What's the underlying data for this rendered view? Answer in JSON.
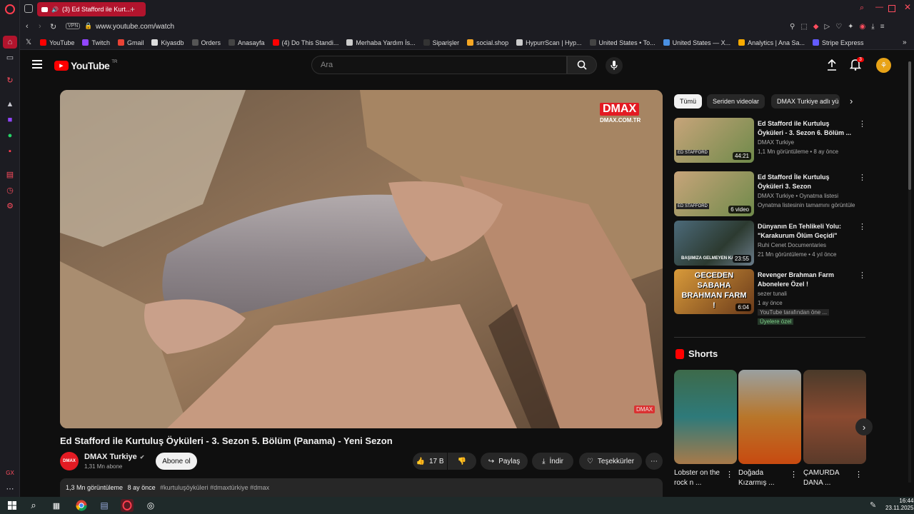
{
  "browser": {
    "tab_title": "(3) Ed Stafford ile Kurt...",
    "url": "www.youtube.com/watch",
    "vpn": "VPN",
    "bookmarks": [
      {
        "label": "YouTube",
        "color": "#ff0000"
      },
      {
        "label": "Twitch",
        "color": "#9146ff"
      },
      {
        "label": "Gmail",
        "color": "#ea4335"
      },
      {
        "label": "Kiyasdb",
        "color": "#dddddd"
      },
      {
        "label": "Orders",
        "color": "#555555"
      },
      {
        "label": "Anasayfa",
        "color": "#444444"
      },
      {
        "label": "(4) Do This Standi...",
        "color": "#ff0000"
      },
      {
        "label": "Merhaba Yardım İs...",
        "color": "#cccccc"
      },
      {
        "label": "Siparişler",
        "color": "#333333"
      },
      {
        "label": "social.shop",
        "color": "#f5a623"
      },
      {
        "label": "HypurrScan | Hyp...",
        "color": "#cccccc"
      },
      {
        "label": "United States • To...",
        "color": "#444444"
      },
      {
        "label": "United States — X...",
        "color": "#4a90e2"
      },
      {
        "label": "Analytics | Ana Sa...",
        "color": "#f9ab00"
      },
      {
        "label": "Stripe Express",
        "color": "#635bff"
      }
    ]
  },
  "youtube": {
    "logo_text": "YouTube",
    "logo_suffix": "TR",
    "search_placeholder": "Ara",
    "notif_count": "3",
    "video": {
      "channel_watermark": "DMAX",
      "watermark_sub": "DMAX.COM.TR",
      "title": "Ed Stafford ile Kurtuluş Öyküleri - 3. Sezon 5. Bölüm (Panama) - Yeni Sezon",
      "channel": "DMAX Turkiye",
      "subscribers": "1,31 Mn abone",
      "subscribe": "Abone ol",
      "likes": "17 B",
      "share": "Paylaş",
      "download": "İndir",
      "thanks": "Teşekkürler",
      "views_line": "1,3 Mn görüntüleme",
      "time_line": "8 ay önce",
      "hashtags": "#kurtuluşöyküleri #dmaxtürkiye #dmax"
    },
    "chips": [
      "Tümü",
      "Seriden videolar",
      "DMAX Turkiye adlı yü"
    ],
    "recommendations": [
      {
        "title": "Ed Stafford ile Kurtuluş Öyküleri - 3. Sezon 6. Bölüm ...",
        "channel": "DMAX Turkiye",
        "meta": "1,1 Mn görüntüleme • 8 ay önce",
        "duration": "44:21"
      },
      {
        "title": "Ed Stafford İle Kurtuluş Öyküleri 3. Sezon",
        "channel": "DMAX Turkiye",
        "channel_extra": "• Oynatma listesi",
        "meta": "Oynatma listesinin tamamını görüntüle",
        "duration": "6 video"
      },
      {
        "title": "Dünyanın En Tehlikeli Yolu: \"Karakurum Ölüm Geçidi\"",
        "channel": "Ruhi Cenet Documentaries",
        "meta": "21 Mn görüntüleme • 4 yıl önce",
        "duration": "23:55"
      },
      {
        "title": "Revenger Brahman Farm Abonelere Özel !",
        "channel": "sezer tunali",
        "meta": "1 ay önce",
        "extra1": "YouTube tarafından öne ...",
        "extra2": "Üyelere özel",
        "duration": "6:04"
      }
    ],
    "shorts_header": "Shorts",
    "shorts": [
      {
        "title": "Lobster on the rock n ..."
      },
      {
        "title": "Doğada Kızarmış ..."
      },
      {
        "title": "ÇAMURDA DANA ..."
      }
    ]
  },
  "taskbar": {
    "time": "16:44",
    "date": "23.11.2025"
  }
}
